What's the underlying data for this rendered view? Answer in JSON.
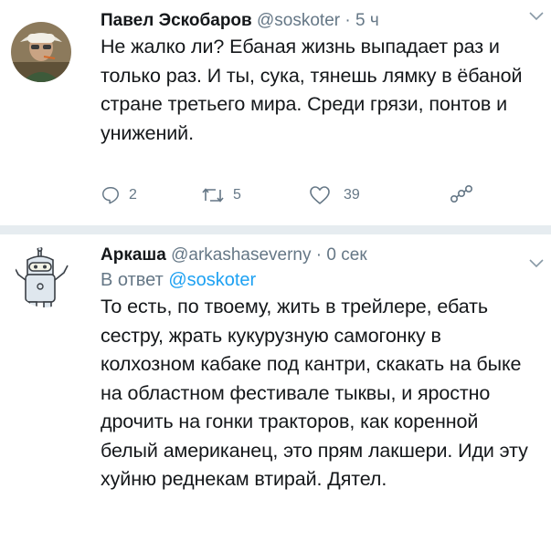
{
  "tweet1": {
    "name": "Павел Эскобаров",
    "handle": "@soskoter",
    "dot": "·",
    "time": "5 ч",
    "text": "Не жалко ли? Ебаная жизнь выпадает раз и только раз. И ты, сука, тянешь лямку в ёбаной стране третьего мира. Среди грязи, понтов и унижений.",
    "icons": {
      "reply": "reply-icon",
      "retweet": "retweet-icon",
      "like": "heart-icon",
      "share": "share-icon",
      "menu": "chevron-down-icon"
    },
    "counts": {
      "reply": "2",
      "retweet": "5",
      "like": "39"
    }
  },
  "tweet2": {
    "name": "Аркаша",
    "handle": "@arkashaseverny",
    "dot": "·",
    "time": "0 сек",
    "reply_prefix": "В ответ",
    "reply_mention": "@soskoter",
    "text": "То есть, по твоему, жить в трейлере, ебать сестру, жрать кукурузную самогонку в колхозном кабаке под кантри, скакать на быке на областном фестивале тыквы, и яростно дрочить на гонки тракторов, как коренной белый американец, это прям лакшери. Иди эту хуйню реднекам втирай. Дятел.",
    "icons": {
      "menu": "chevron-down-icon"
    }
  },
  "colors": {
    "text": "#14171a",
    "muted": "#657786",
    "accent": "#1da1f2",
    "separator": "#e6ecf0"
  }
}
